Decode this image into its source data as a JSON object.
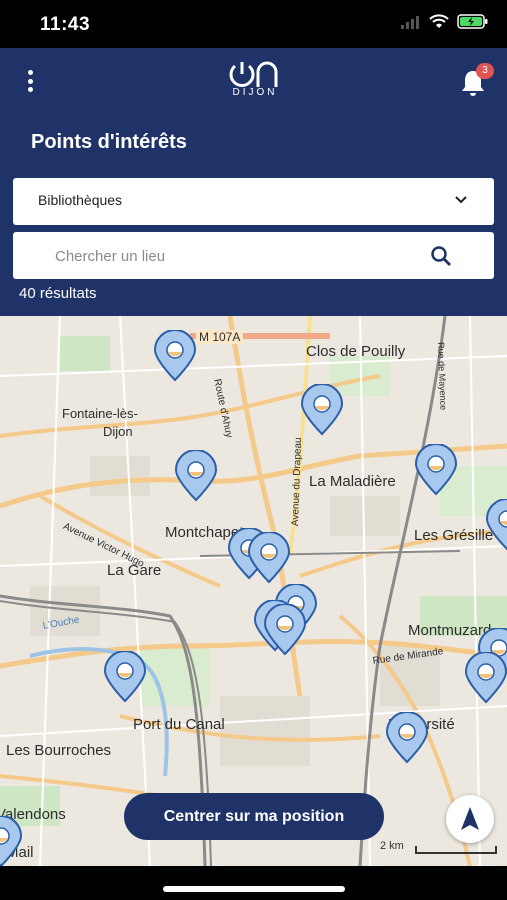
{
  "status_bar": {
    "time": "11:43"
  },
  "header": {
    "logo_main": "on",
    "logo_sub": "DIJON",
    "notification_count": "3"
  },
  "page": {
    "title": "Points d'intérêts"
  },
  "filter": {
    "selected": "Bibliothèques"
  },
  "search": {
    "placeholder": "Chercher un lieu",
    "value": ""
  },
  "results": {
    "text": "40 résultats"
  },
  "map": {
    "labels": [
      "M 107A",
      "Clos de Pouilly",
      "Fontaine-lès-",
      "Dijon",
      "La Maladière",
      "Montchapet",
      "Les Grésille",
      "Avenue Victor Hugo",
      "La Gare",
      "Montmuzard",
      "Rue de Mirande",
      "Port du Canal",
      "Les Bourroches",
      "Université",
      "Valendons",
      "Mail",
      "Route d'Ahuy",
      "Avenue du Drapeau",
      "Rue de Mayence",
      "L'Ouche",
      "2 km"
    ]
  },
  "actions": {
    "center_label": "Centrer sur ma position"
  },
  "colors": {
    "header": "#1f3368",
    "pin": "#a8c8ee",
    "pin_stroke": "#2b5fa8",
    "badge": "#e05353"
  },
  "icons": [
    "wifi-icon",
    "battery-icon",
    "menu-icon",
    "bell-icon",
    "chevron-down-icon",
    "search-icon",
    "location-pin-icon",
    "navigation-arrow-icon"
  ]
}
